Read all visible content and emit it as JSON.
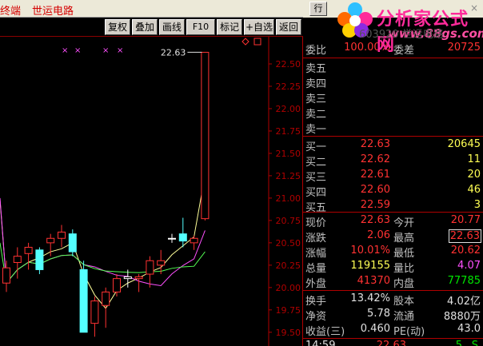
{
  "window": {
    "app_title_fragment": "终端",
    "stock_name": "世运电路",
    "right_button": "行",
    "close_glyph": "×"
  },
  "logo": {
    "text": "分析家公式网",
    "url": "www.88gs.com",
    "ghost_text": "603920 世运电路"
  },
  "toolbar": {
    "buttons": [
      "复权",
      "叠加",
      "画线",
      "F10",
      "标记",
      "+自选",
      "返回"
    ]
  },
  "chart_data": {
    "type": "candlestick",
    "y_ticks": [
      "22.50",
      "22.25",
      "22.00",
      "21.75",
      "21.50",
      "21.25",
      "21.00",
      "20.75",
      "20.50",
      "20.25",
      "20.00",
      "19.75",
      "19.50"
    ],
    "ylim": [
      19.4,
      22.75
    ],
    "max_label": "22.63",
    "candles": [
      {
        "o": 20.22,
        "h": 20.3,
        "l": 19.95,
        "c": 20.05,
        "color": "red"
      },
      {
        "o": 20.28,
        "h": 20.45,
        "l": 20.1,
        "c": 20.35,
        "color": "red"
      },
      {
        "o": 20.38,
        "h": 20.5,
        "l": 20.2,
        "c": 20.45,
        "color": "red"
      },
      {
        "o": 20.42,
        "h": 20.45,
        "l": 20.15,
        "c": 20.2,
        "color": "cyan"
      },
      {
        "o": 20.5,
        "h": 20.6,
        "l": 20.35,
        "c": 20.55,
        "color": "red"
      },
      {
        "o": 20.62,
        "h": 20.7,
        "l": 20.45,
        "c": 20.55,
        "color": "red"
      },
      {
        "o": 20.6,
        "h": 20.65,
        "l": 20.35,
        "c": 20.4,
        "color": "cyan"
      },
      {
        "o": 20.2,
        "h": 20.3,
        "l": 19.5,
        "c": 19.5,
        "color": "cyan"
      },
      {
        "o": 19.6,
        "h": 19.9,
        "l": 19.45,
        "c": 19.85,
        "color": "red"
      },
      {
        "o": 19.8,
        "h": 20.0,
        "l": 19.55,
        "c": 19.95,
        "color": "red"
      },
      {
        "o": 19.95,
        "h": 20.15,
        "l": 19.9,
        "c": 20.1,
        "color": "red"
      },
      {
        "o": 20.12,
        "h": 20.2,
        "l": 20.0,
        "c": 20.1,
        "color": "white"
      },
      {
        "o": 20.1,
        "h": 20.15,
        "l": 19.95,
        "c": 20.12,
        "color": "red"
      },
      {
        "o": 20.15,
        "h": 20.35,
        "l": 20.0,
        "c": 20.3,
        "color": "red"
      },
      {
        "o": 20.3,
        "h": 20.42,
        "l": 20.15,
        "c": 20.25,
        "color": "red"
      },
      {
        "o": 20.55,
        "h": 20.6,
        "l": 20.5,
        "c": 20.55,
        "color": "white"
      },
      {
        "o": 20.52,
        "h": 20.78,
        "l": 20.45,
        "c": 20.6,
        "color": "cyan"
      },
      {
        "o": 20.5,
        "h": 20.58,
        "l": 20.42,
        "c": 20.55,
        "color": "red"
      },
      {
        "o": 20.77,
        "h": 22.63,
        "l": 20.75,
        "c": 22.63,
        "color": "red"
      }
    ]
  },
  "quote": {
    "webi": {
      "label": "委比",
      "value": "100.00%",
      "label2": "委差",
      "value2": "20725"
    },
    "sell": [
      {
        "label": "卖五",
        "price": "",
        "vol": ""
      },
      {
        "label": "卖四",
        "price": "",
        "vol": ""
      },
      {
        "label": "卖三",
        "price": "",
        "vol": ""
      },
      {
        "label": "卖二",
        "price": "",
        "vol": ""
      },
      {
        "label": "卖一",
        "price": "",
        "vol": ""
      }
    ],
    "buy": [
      {
        "label": "买一",
        "price": "22.63",
        "vol": "20645"
      },
      {
        "label": "买二",
        "price": "22.62",
        "vol": "11"
      },
      {
        "label": "买三",
        "price": "22.61",
        "vol": "20"
      },
      {
        "label": "买四",
        "price": "22.60",
        "vol": "46"
      },
      {
        "label": "买五",
        "price": "22.59",
        "vol": "3"
      }
    ],
    "stats1": [
      {
        "l1": "现价",
        "v1": "22.63",
        "c1": "red",
        "l2": "今开",
        "v2": "20.77",
        "c2": "red"
      },
      {
        "l1": "涨跌",
        "v1": "2.06",
        "c1": "red",
        "l2": "最高",
        "v2": "22.63",
        "c2": "red"
      },
      {
        "l1": "涨幅",
        "v1": "10.01%",
        "c1": "red",
        "l2": "最低",
        "v2": "20.62",
        "c2": "red"
      },
      {
        "l1": "总量",
        "v1": "119155",
        "c1": "yel",
        "l2": "量比",
        "v2": "4.07",
        "c2": "mag"
      },
      {
        "l1": "外盘",
        "v1": "41370",
        "c1": "red",
        "l2": "内盘",
        "v2": "77785",
        "c2": "grn"
      }
    ],
    "stats2": [
      {
        "l1": "换手",
        "v1": "13.42%",
        "l2": "股本",
        "v2": "4.02亿"
      },
      {
        "l1": "净资",
        "v1": "5.78",
        "l2": "流通",
        "v2": "8880万"
      },
      {
        "l1": "收益(三)",
        "v1": "0.460",
        "l2": "PE(动)",
        "v2": "43.0"
      }
    ],
    "tick": {
      "time": "14:59",
      "price": "22.63",
      "vol": "5",
      "side": "S"
    }
  }
}
